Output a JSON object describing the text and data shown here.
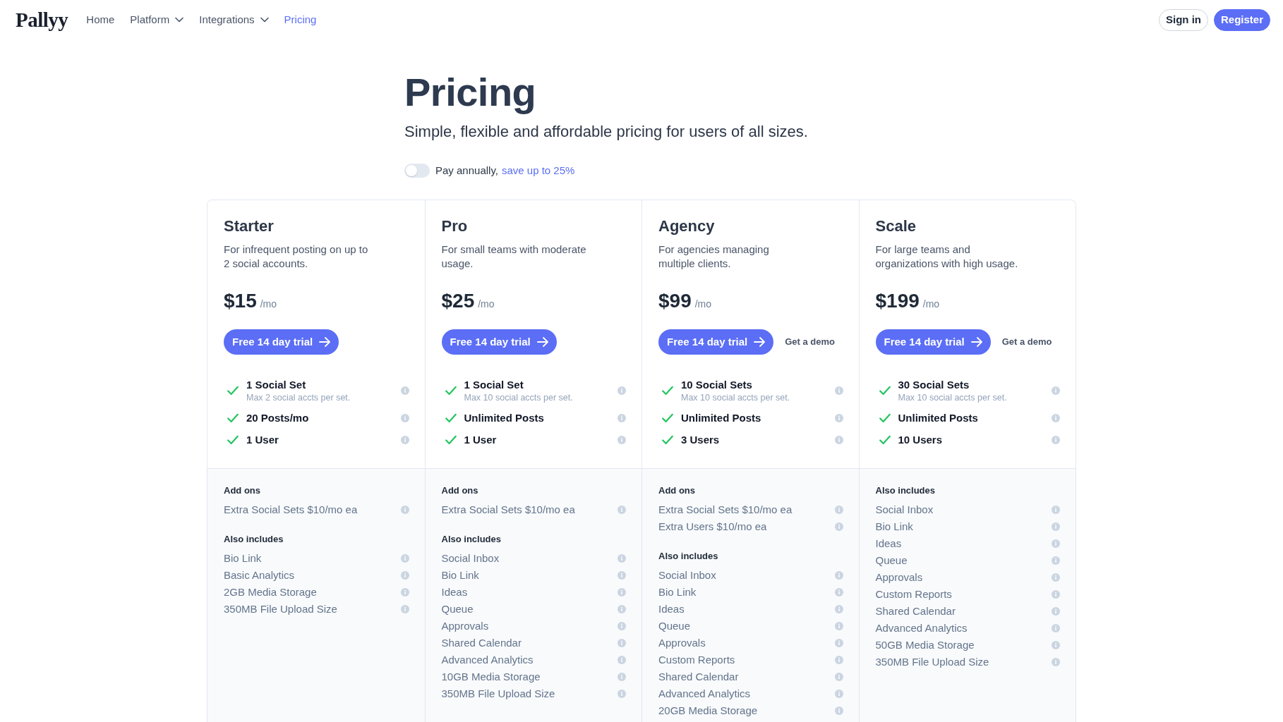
{
  "navbar": {
    "logo": "Pallyy",
    "links": [
      {
        "label": "Home",
        "kind": "link",
        "selected": false
      },
      {
        "label": "Platform",
        "kind": "dropdown",
        "selected": false
      },
      {
        "label": "Integrations",
        "kind": "dropdown",
        "selected": false
      },
      {
        "label": "Pricing",
        "kind": "link",
        "selected": true
      }
    ],
    "buttons": [
      {
        "label": "Sign in",
        "kind": "outline"
      },
      {
        "label": "Register",
        "kind": "primary"
      }
    ]
  },
  "header": {
    "title": "Pricing",
    "subtitle": "Simple, flexible and affordable pricing for users of all sizes.",
    "billing_toggle": {
      "on": false,
      "label": "Pay annually,",
      "link": "save up to 25%"
    }
  },
  "plans": [
    {
      "name": "Starter",
      "description": "For infrequent posting on up to\n2 social accounts.",
      "price": "$15",
      "period": "/mo",
      "trial_button": "Free 14 day trial",
      "features": [
        {
          "title": "1 Social Set",
          "note": "Max 2 social accts per set."
        },
        {
          "title": "20 Posts/mo"
        },
        {
          "title": "1 User"
        }
      ],
      "sections": [
        {
          "heading": "Add ons",
          "items": [
            "Extra Social Sets $10/mo ea"
          ]
        },
        {
          "heading": "Also includes",
          "items": [
            "Bio Link",
            "Basic Analytics",
            "2GB Media Storage",
            "350MB File Upload Size"
          ]
        }
      ]
    },
    {
      "name": "Pro",
      "description": "For small teams with moderate\nusage.",
      "price": "$25",
      "period": "/mo",
      "trial_button": "Free 14 day trial",
      "features": [
        {
          "title": "1 Social Set",
          "note": "Max 10 social accts per set."
        },
        {
          "title": "Unlimited Posts"
        },
        {
          "title": "1 User"
        }
      ],
      "sections": [
        {
          "heading": "Add ons",
          "items": [
            "Extra Social Sets $10/mo ea"
          ]
        },
        {
          "heading": "Also includes",
          "items": [
            "Social Inbox",
            "Bio Link",
            "Ideas",
            "Queue",
            "Approvals",
            "Shared Calendar",
            "Advanced Analytics",
            "10GB Media Storage",
            "350MB File Upload Size"
          ]
        }
      ]
    },
    {
      "name": "Agency",
      "description": "For agencies managing\nmultiple clients.",
      "price": "$99",
      "period": "/mo",
      "trial_button": "Free 14 day trial",
      "demo_link": "Get a demo",
      "features": [
        {
          "title": "10 Social Sets",
          "note": "Max 10 social accts per set."
        },
        {
          "title": "Unlimited Posts"
        },
        {
          "title": "3 Users"
        }
      ],
      "sections": [
        {
          "heading": "Add ons",
          "items": [
            "Extra Social Sets $10/mo ea",
            "Extra Users $10/mo ea"
          ]
        },
        {
          "heading": "Also includes",
          "items": [
            "Social Inbox",
            "Bio Link",
            "Ideas",
            "Queue",
            "Approvals",
            "Custom Reports",
            "Shared Calendar",
            "Advanced Analytics",
            "20GB Media Storage"
          ]
        }
      ]
    },
    {
      "name": "Scale",
      "description": "For large teams and\norganizations with high usage.",
      "price": "$199",
      "period": "/mo",
      "trial_button": "Free 14 day trial",
      "demo_link": "Get a demo",
      "features": [
        {
          "title": "30 Social Sets",
          "note": "Max 10 social accts per set."
        },
        {
          "title": "Unlimited Posts"
        },
        {
          "title": "10 Users"
        }
      ],
      "sections": [
        {
          "heading": "Also includes",
          "items": [
            "Social Inbox",
            "Bio Link",
            "Ideas",
            "Queue",
            "Approvals",
            "Custom Reports",
            "Shared Calendar",
            "Advanced Analytics",
            "50GB Media Storage",
            "350MB File Upload Size"
          ]
        }
      ]
    }
  ]
}
